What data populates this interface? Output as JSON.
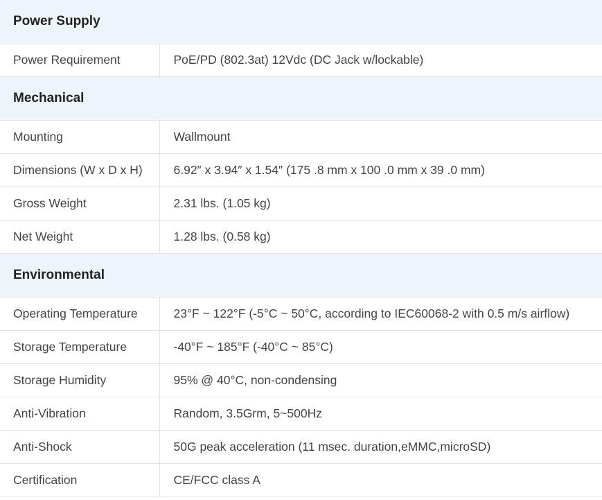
{
  "sections": [
    {
      "title": "Power Supply",
      "rows": [
        {
          "label": "Power Requirement",
          "value": "PoE/PD (802.3at) 12Vdc (DC Jack w/lockable)"
        }
      ]
    },
    {
      "title": "Mechanical",
      "rows": [
        {
          "label": "Mounting",
          "value": "Wallmount"
        },
        {
          "label": "Dimensions (W x D x H)",
          "value": "6.92″ x 3.94″ x 1.54″ (175 .8 mm x 100 .0 mm x 39 .0 mm)"
        },
        {
          "label": "Gross Weight",
          "value": "2.31 lbs. (1.05 kg)"
        },
        {
          "label": "Net Weight",
          "value": "1.28 lbs. (0.58 kg)"
        }
      ]
    },
    {
      "title": "Environmental",
      "rows": [
        {
          "label": "Operating Temperature",
          "value": "23°F ~ 122°F (-5°C ~ 50°C, according to IEC60068-2 with 0.5 m/s airflow)"
        },
        {
          "label": "Storage Temperature",
          "value": "-40°F ~ 185°F (-40°C ~ 85°C)"
        },
        {
          "label": "Storage Humidity",
          "value": "95% @ 40°C, non-condensing"
        },
        {
          "label": "Anti-Vibration",
          "value": "Random, 3.5Grm, 5~500Hz"
        },
        {
          "label": "Anti-Shock",
          "value": "50G peak acceleration (11 msec. duration,eMMC,microSD)"
        },
        {
          "label": "Certification",
          "value": "CE/FCC class A"
        }
      ]
    }
  ]
}
